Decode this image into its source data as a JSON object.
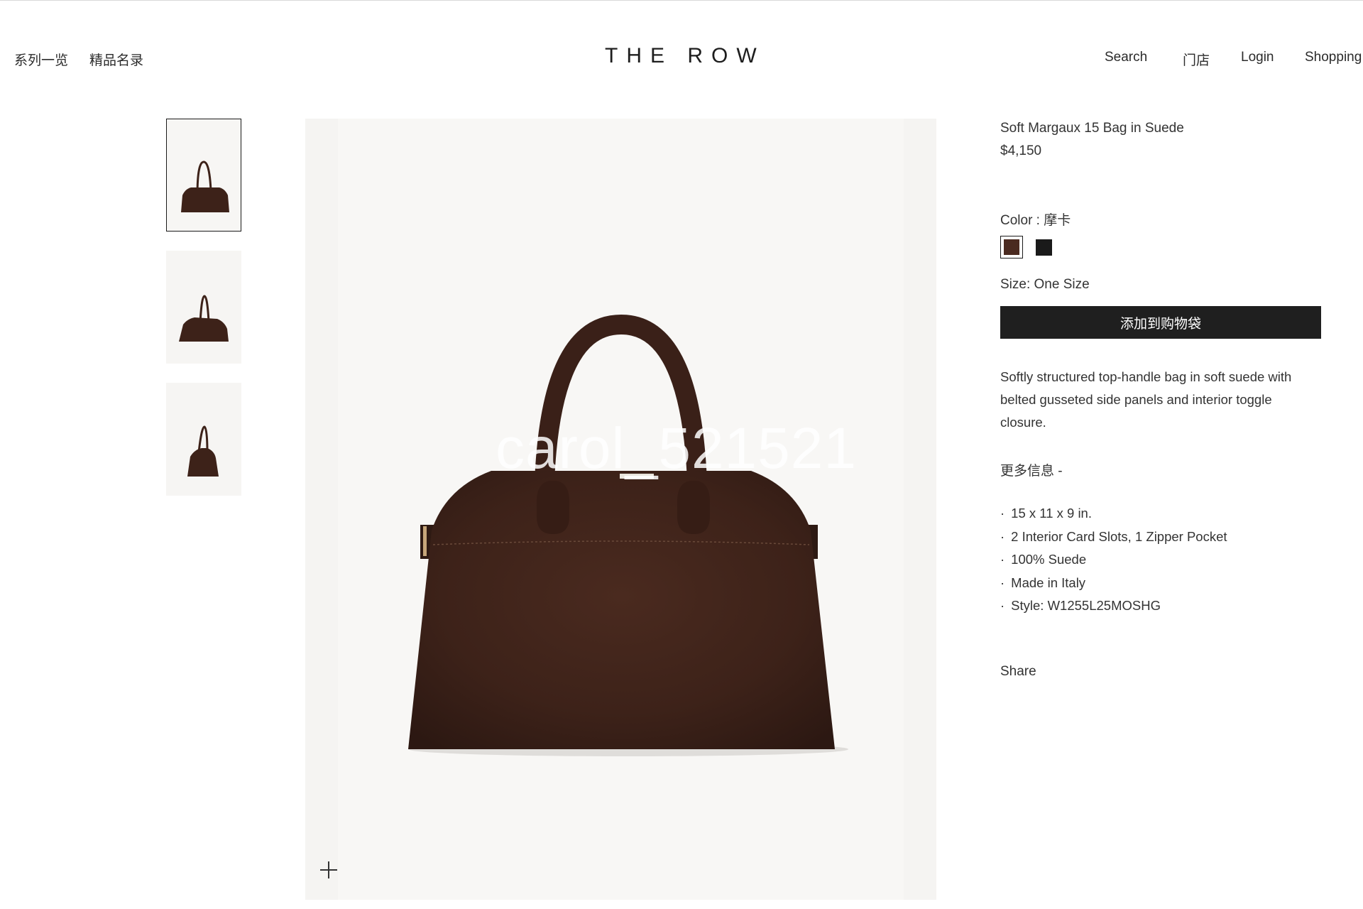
{
  "header": {
    "nav_left": [
      "系列一览",
      "精品名录"
    ],
    "logo": "THE ROW",
    "nav_right": {
      "search": "Search",
      "stores": "门店",
      "login": "Login",
      "shopping": "Shopping"
    }
  },
  "gallery": {
    "thumbnails": [
      "bag-front-view",
      "bag-angle-view",
      "bag-side-view"
    ],
    "active_index": 0,
    "zoom_icon": "plus-icon",
    "watermark": "carol_521521"
  },
  "product": {
    "title": "Soft Margaux 15 Bag in Suede",
    "price": "$4,150",
    "color_label": "Color : 摩卡",
    "swatches": [
      {
        "name": "摩卡",
        "hex": "#4a2a20",
        "selected": true
      },
      {
        "name": "black",
        "hex": "#1a1a1a",
        "selected": false
      }
    ],
    "size_label": "Size: One Size",
    "add_to_bag": "添加到购物袋",
    "description": "Softly structured top-handle bag in soft suede with belted gusseted side panels and interior toggle closure.",
    "more_info": "更多信息 -",
    "details": [
      "15 x 11 x 9 in.",
      "2 Interior Card Slots, 1 Zipper Pocket",
      "100% Suede",
      "Made in Italy",
      "Style: W1255L25MOSHG"
    ],
    "share": "Share"
  },
  "colors": {
    "bag_brown": "#3d2219",
    "button_bg": "#1f1f1f",
    "image_bg": "#f5f4f2"
  }
}
